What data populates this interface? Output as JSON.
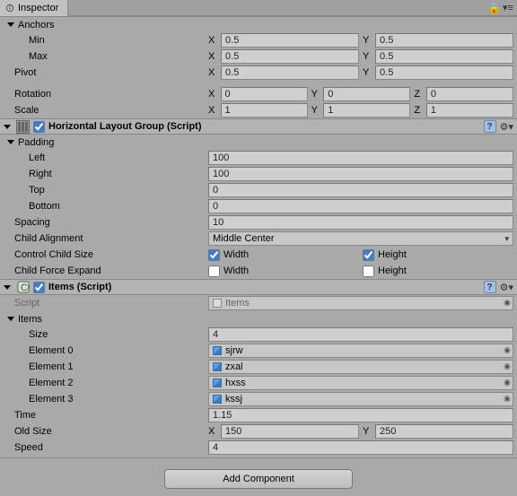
{
  "tab": {
    "title": "Inspector"
  },
  "anchors": {
    "header": "Anchors",
    "min_label": "Min",
    "min_x": "0.5",
    "min_y": "0.5",
    "max_label": "Max",
    "max_x": "0.5",
    "max_y": "0.5"
  },
  "pivot": {
    "label": "Pivot",
    "x": "0.5",
    "y": "0.5"
  },
  "rotation": {
    "label": "Rotation",
    "x": "0",
    "y": "0",
    "z": "0"
  },
  "scale": {
    "label": "Scale",
    "x": "1",
    "y": "1",
    "z": "1"
  },
  "axis": {
    "x": "X",
    "y": "Y",
    "z": "Z"
  },
  "hlg": {
    "title": "Horizontal Layout Group (Script)",
    "padding": {
      "header": "Padding",
      "left_label": "Left",
      "left": "100",
      "right_label": "Right",
      "right": "100",
      "top_label": "Top",
      "top": "0",
      "bottom_label": "Bottom",
      "bottom": "0"
    },
    "spacing_label": "Spacing",
    "spacing": "10",
    "align_label": "Child Alignment",
    "align": "Middle Center",
    "ccs_label": "Control Child Size",
    "ccs_w": "Width",
    "ccs_h": "Height",
    "ccs_w_checked": true,
    "ccs_h_checked": true,
    "cfe_label": "Child Force Expand",
    "cfe_w": "Width",
    "cfe_h": "Height",
    "cfe_w_checked": false,
    "cfe_h_checked": false
  },
  "items": {
    "title": "Items (Script)",
    "script_label": "Script",
    "script_value": "Items",
    "array_header": "Items",
    "size_label": "Size",
    "size": "4",
    "el0_label": "Element 0",
    "el0": "sjrw",
    "el1_label": "Element 1",
    "el1": "zxal",
    "el2_label": "Element 2",
    "el2": "hxss",
    "el3_label": "Element 3",
    "el3": "kssj",
    "time_label": "Time",
    "time": "1.15",
    "oldsize_label": "Old Size",
    "oldsize_x": "150",
    "oldsize_y": "250",
    "speed_label": "Speed",
    "speed": "4"
  },
  "add_btn": "Add Component"
}
